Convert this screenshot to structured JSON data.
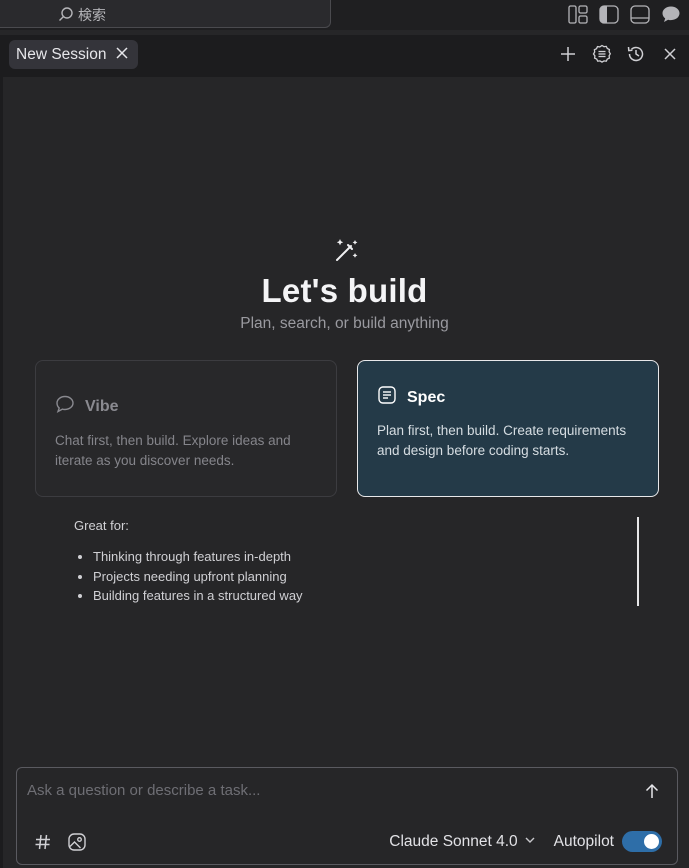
{
  "titlebar": {
    "search_label": "検索",
    "icons": [
      "layout-panels-icon",
      "toggle-sidebar-icon",
      "toggle-panel-icon",
      "chat-icon"
    ]
  },
  "tabs": [
    {
      "label": "New Session",
      "active": true
    }
  ],
  "tab_actions": [
    "plus-icon",
    "checklist-icon",
    "history-icon",
    "close-icon"
  ],
  "hero": {
    "icon": "magic-wand-icon",
    "title": "Let's build",
    "subtitle": "Plan, search, or build anything"
  },
  "modes": [
    {
      "id": "vibe",
      "icon": "speech-bubble-icon",
      "title": "Vibe",
      "description": "Chat first, then build. Explore ideas and iterate as you discover needs.",
      "selected": false
    },
    {
      "id": "spec",
      "icon": "document-lines-icon",
      "title": "Spec",
      "description": "Plan first, then build. Create requirements and design before coding starts.",
      "selected": true
    }
  ],
  "great_for": {
    "heading": "Great for:",
    "items": [
      "Thinking through features in-depth",
      "Projects needing upfront planning",
      "Building features in a structured way"
    ]
  },
  "composer": {
    "placeholder": "Ask a question or describe a task...",
    "value": "",
    "model": "Claude Sonnet 4.0",
    "autopilot_label": "Autopilot",
    "autopilot_on": true
  },
  "colors": {
    "background": "#262628",
    "accent_card": "#243a48",
    "toggle_on": "#2e6ea8"
  }
}
